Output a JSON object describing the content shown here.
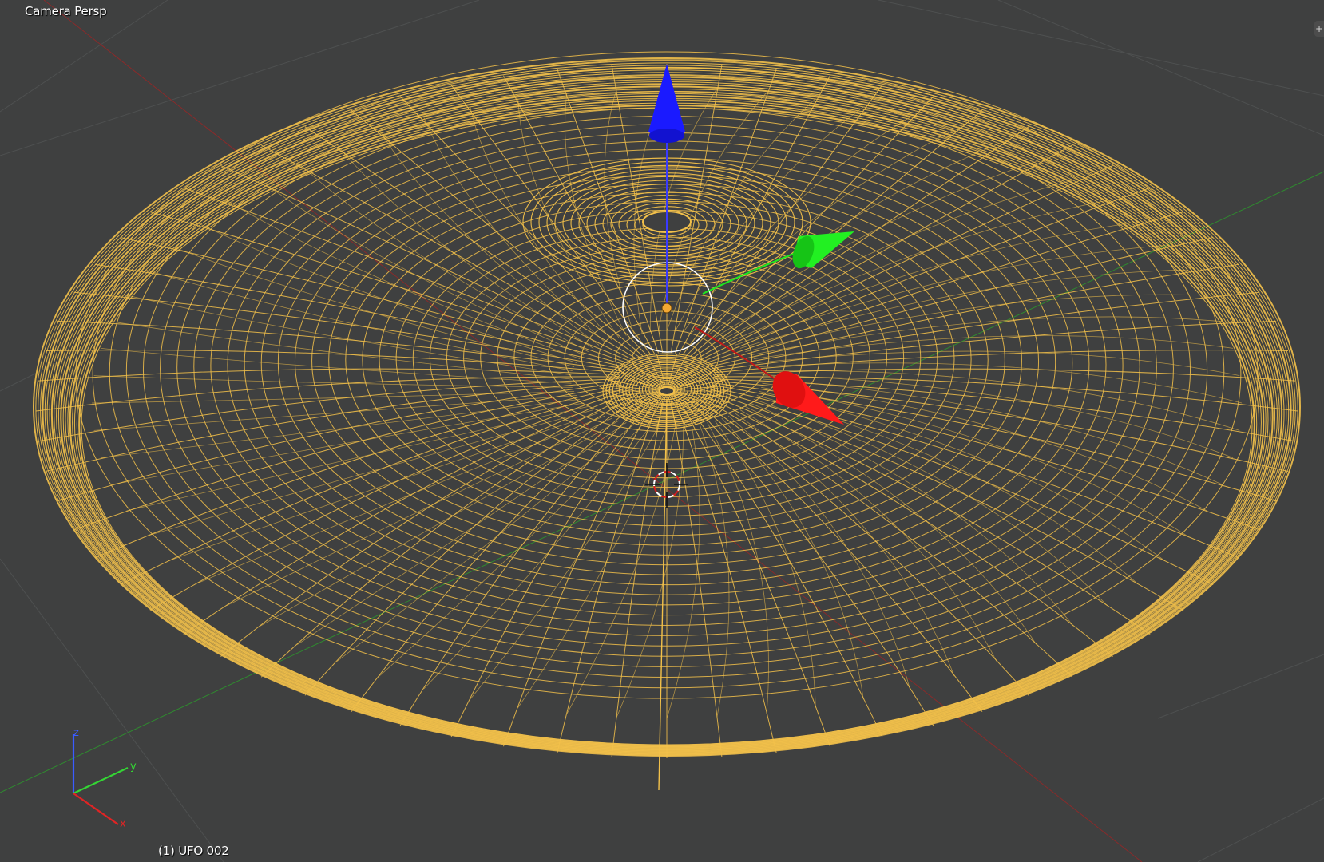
{
  "viewport": {
    "view_label": "Camera Persp",
    "object_label": "(1) UFO 002",
    "corner_widget_glyph": "+",
    "background_color": "#3f4040"
  },
  "object": {
    "name": "UFO 002",
    "display": "wireframe",
    "selected": true,
    "wire_color": "#f3c14a"
  },
  "gizmo": {
    "axes": [
      {
        "axis": "z",
        "color": "#1a1aff"
      },
      {
        "axis": "y",
        "color": "#1fe81f"
      },
      {
        "axis": "x",
        "color": "#ff1414"
      }
    ]
  },
  "axis_widget": {
    "labels": [
      "z",
      "y",
      "x"
    ],
    "colors": {
      "z": "#3a5cff",
      "y": "#34d634",
      "x": "#e02424"
    }
  },
  "icons": {
    "corner_widget": "plus-icon",
    "cursor": "3d-cursor-icon",
    "origin": "object-origin-icon"
  }
}
